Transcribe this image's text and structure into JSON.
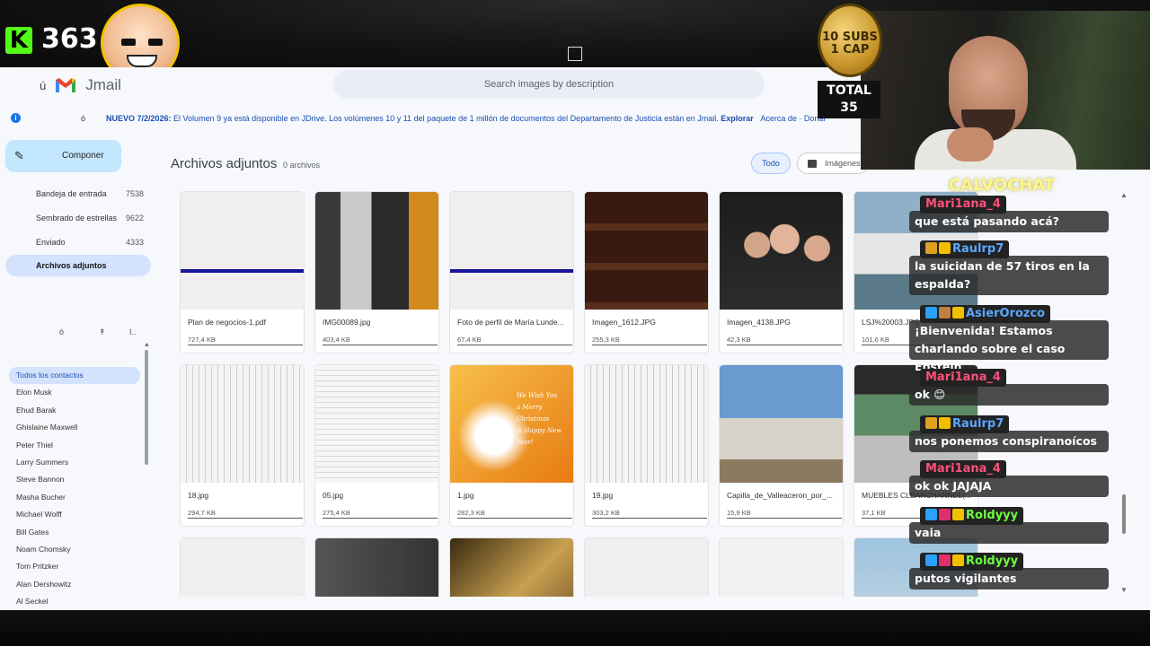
{
  "stream": {
    "viewer_count": "363",
    "coin_line1": "10 SUBS",
    "coin_line2": "1 CAP",
    "total_label": "TOTAL",
    "total_value": "35",
    "chat_title": "CALVOCHAT"
  },
  "app": {
    "account_glyph": "ú",
    "brand": "Jmail",
    "search_placeholder": "Search images by description",
    "banner": {
      "glyph": "ó",
      "text_prefix": "NUEVO 7/2/2026:",
      "text_body": " El Volumen 9 ya está disponible en ",
      "link1": "JDrive",
      "text_body2": ". Los volúmenes 10 y 11 del paquete de 1 millón de documentos del Departamento de Justicia están en Jmail. ",
      "link2": "Explorar",
      "link3": "Acerca de",
      "link4": "Donar"
    },
    "compose_label": "Componer",
    "nav": [
      {
        "label": "Bandeja de entrada",
        "count": "7538"
      },
      {
        "label": "Sembrado de estrellas",
        "count": "9622"
      },
      {
        "label": "Enviado",
        "count": "4333"
      },
      {
        "label": "Archivos adjuntos",
        "count": ""
      }
    ],
    "icon_row": [
      "ó",
      "↟",
      "I.."
    ],
    "contacts": [
      "Todos los contactos",
      "Elon Musk",
      "Ehud Barak",
      "Ghislaine Maxwell",
      "Peter Thiel",
      "Larry Summers",
      "Steve Bannon",
      "Masha Bucher",
      "Michael Wolff",
      "Bill Gates",
      "Noam Chomsky",
      "Tom Pritzker",
      "Alan Dershowitz",
      "Al Seckel"
    ],
    "page_title": "Archivos adjuntos",
    "page_count": "0 archivos",
    "filters": {
      "all": "Todo",
      "images": "Imágenes"
    },
    "files": [
      {
        "name": "Plan de negocios-1.pdf",
        "size": "727,4 KB"
      },
      {
        "name": "IMG00089.jpg",
        "size": "403,4 KB"
      },
      {
        "name": "Foto de perfil de María Lunde...",
        "size": "67,4 KB"
      },
      {
        "name": "Imagen_1612.JPG",
        "size": "255,3 KB"
      },
      {
        "name": "Imagen_4138.JPG",
        "size": "42,3 KB"
      },
      {
        "name": "LSJ%20003.JPG",
        "size": "101,6 KB"
      },
      {
        "name": "18.jpg",
        "size": "294,7 KB"
      },
      {
        "name": "05.jpg",
        "size": "275,4 KB"
      },
      {
        "name": "1.jpg",
        "size": "282,3 KB"
      },
      {
        "name": "19.jpg",
        "size": "303,2 KB"
      },
      {
        "name": "Capilla_de_Valleaceron_por_...",
        "size": "15,9 KB"
      },
      {
        "name": "MUEBLES CLEARCHANNEL(...",
        "size": "37,1 KB"
      },
      {
        "name": "",
        "size": ""
      },
      {
        "name": "",
        "size": ""
      },
      {
        "name": "",
        "size": ""
      },
      {
        "name": "",
        "size": ""
      },
      {
        "name": "",
        "size": ""
      },
      {
        "name": "",
        "size": ""
      }
    ],
    "card_overlay_texts": [
      "We Wish You",
      "a Merry Christmas",
      "& Happy New Year!"
    ]
  },
  "chat": [
    {
      "user": "Mari1ana_4",
      "color": "#ff4f7b",
      "badges": [],
      "text": "que está pasando acá?"
    },
    {
      "user": "Raulrp7",
      "color": "#5aa7ff",
      "badges": [
        "#e0a020",
        "#f0c000"
      ],
      "text": "la suicidan de 57 tiros en la espalda?"
    },
    {
      "user": "AsierOrozco",
      "color": "#5aa7ff",
      "badges": [
        "#2aa0ff",
        "#c08040",
        "#f0c000"
      ],
      "text": "¡Bienvenida! Estamos charlando sobre el caso Epstein"
    },
    {
      "user": "Mari1ana_4",
      "color": "#ff4f7b",
      "badges": [],
      "text": "ok 😊"
    },
    {
      "user": "Raulrp7",
      "color": "#5aa7ff",
      "badges": [
        "#e0a020",
        "#f0c000"
      ],
      "text": "nos ponemos conspiranoícos"
    },
    {
      "user": "Mari1ana_4",
      "color": "#ff4f7b",
      "badges": [],
      "text": "ok ok JAJAJA"
    },
    {
      "user": "Roldyyy",
      "color": "#6bff3f",
      "badges": [
        "#2aa0ff",
        "#e0306a",
        "#f0c000"
      ],
      "text": "vaia"
    },
    {
      "user": "Roldyyy",
      "color": "#6bff3f",
      "badges": [
        "#2aa0ff",
        "#e0306a",
        "#f0c000"
      ],
      "text": "putos vigilantes"
    }
  ],
  "colors": {
    "accent": "#1a73e8",
    "kick_green": "#53fc18",
    "chip_bg": "#e8f0fe"
  }
}
